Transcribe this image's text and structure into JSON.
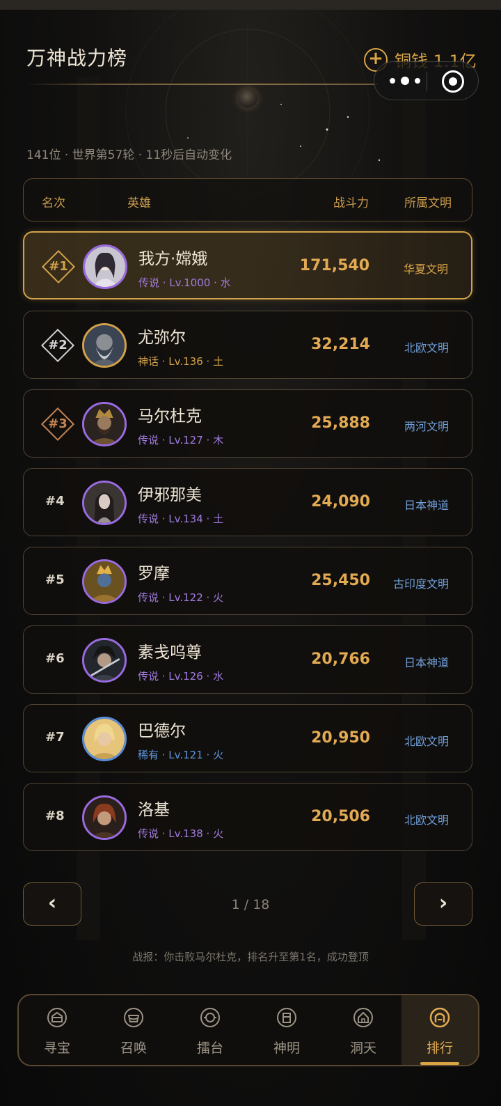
{
  "header": {
    "title": "万神战力榜",
    "coin_label": "铜钱 1.1亿",
    "plus_icon": "+"
  },
  "subtitle": "141位 · 世界第57轮 · 11秒后自动变化",
  "table": {
    "headers": {
      "rank": "名次",
      "hero": "英雄",
      "power": "战斗力",
      "civ": "所属文明"
    },
    "rows": [
      {
        "rank": "#1",
        "name": "我方·嫦娥",
        "meta": "传说 · Lv.1000 · 水",
        "power": "171,540",
        "civ": "华夏文明"
      },
      {
        "rank": "#2",
        "name": "尤弥尔",
        "meta": "神话 · Lv.136 · 土",
        "power": "32,214",
        "civ": "北欧文明"
      },
      {
        "rank": "#3",
        "name": "马尔杜克",
        "meta": "传说 · Lv.127 · 木",
        "power": "25,888",
        "civ": "两河文明"
      },
      {
        "rank": "#4",
        "name": "伊邪那美",
        "meta": "传说 · Lv.134 · 土",
        "power": "24,090",
        "civ": "日本神道"
      },
      {
        "rank": "#5",
        "name": "罗摩",
        "meta": "传说 · Lv.122 · 火",
        "power": "25,450",
        "civ": "古印度文明"
      },
      {
        "rank": "#6",
        "name": "素戋呜尊",
        "meta": "传说 · Lv.126 · 水",
        "power": "20,766",
        "civ": "日本神道"
      },
      {
        "rank": "#7",
        "name": "巴德尔",
        "meta": "稀有 · Lv.121 · 火",
        "power": "20,950",
        "civ": "北欧文明"
      },
      {
        "rank": "#8",
        "name": "洛基",
        "meta": "传说 · Lv.138 · 火",
        "power": "20,506",
        "civ": "北欧文明"
      }
    ]
  },
  "pager": {
    "prev": "‹",
    "next": "›",
    "text": "1 / 18"
  },
  "report": "战报：你击败马尔杜克，排名升至第1名，成功登顶",
  "tabs": [
    {
      "label": "寻宝",
      "icon": "treasure-icon"
    },
    {
      "label": "召唤",
      "icon": "summon-icon"
    },
    {
      "label": "擂台",
      "icon": "arena-icon"
    },
    {
      "label": "神明",
      "icon": "deity-icon"
    },
    {
      "label": "洞天",
      "icon": "home-icon"
    },
    {
      "label": "排行",
      "icon": "ranking-icon",
      "active": true
    }
  ],
  "colors": {
    "accent_gold": "#d9a545",
    "rarity_legend": "#a27be0",
    "rarity_rare": "#5f95e0",
    "civ_text": "#6f9fd9"
  }
}
